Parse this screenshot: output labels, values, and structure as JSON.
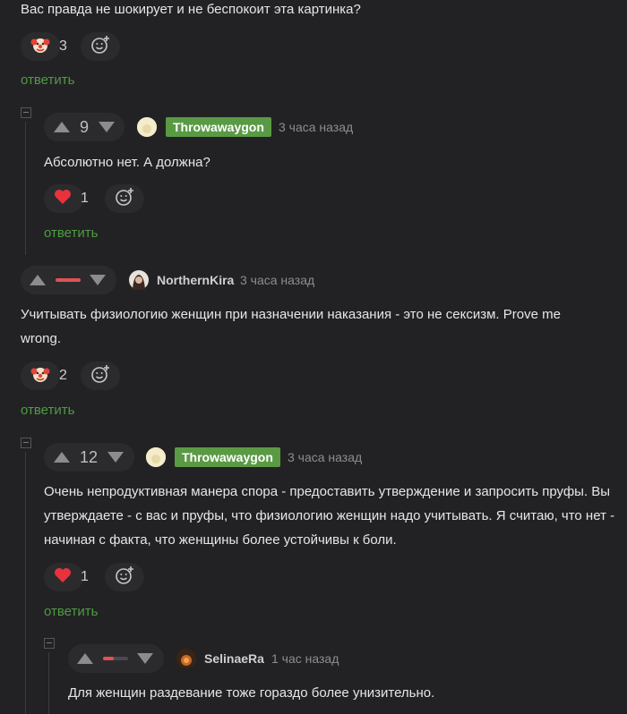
{
  "comments": {
    "c0": {
      "text": "Вас правда не шокирует и не беспокоит эта картинка?",
      "reaction_icon": "clown-face-icon",
      "reaction_count": "3",
      "reply_label": "ответить"
    },
    "c1": {
      "score": "9",
      "author": "Throwawaygon",
      "time": "3 часа назад",
      "text": "Абсолютно нет. А должна?",
      "reaction_icon": "heart-icon",
      "reaction_count": "1",
      "reply_label": "ответить"
    },
    "c2": {
      "author": "NorthernKira",
      "time": "3 часа назад",
      "text": "Учитывать физиологию женщин при назначении наказания - это не сексизм. Prove me wrong.",
      "reaction_icon": "clown-face-icon",
      "reaction_count": "2",
      "reply_label": "ответить"
    },
    "c3": {
      "score": "12",
      "author": "Throwawaygon",
      "time": "3 часа назад",
      "text": "Очень непродуктивная манера спора - предоставить утверждение и запросить пруфы. Вы утверждаете - с вас и пруфы, что физиологию женщин надо учитывать. Я считаю, что нет - начиная с факта, что женщины более устойчивы к боли.",
      "reaction_icon": "heart-icon",
      "reaction_count": "1",
      "reply_label": "ответить"
    },
    "c4": {
      "author": "SelinaeRa",
      "time": "1 час назад",
      "text": "Для женщин раздевание тоже гораздо более унизительно."
    }
  },
  "colors": {
    "accent_green": "#5a9a44",
    "reply_green": "#4f9b43",
    "negative_red": "#e05252",
    "heart_red": "#e8323c"
  }
}
